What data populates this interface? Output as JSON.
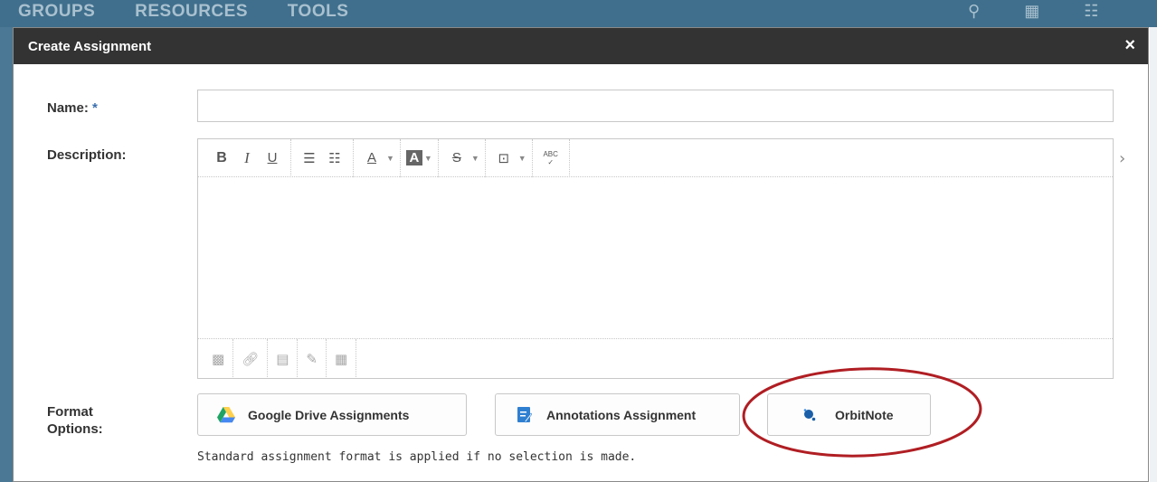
{
  "background": {
    "nav": [
      "GROUPS",
      "RESOURCES",
      "TOOLS"
    ],
    "icons": [
      "search-icon",
      "grid-icon",
      "apps-icon"
    ]
  },
  "dialog": {
    "title": "Create Assignment",
    "close_label": "×",
    "name_label": "Name:",
    "required_mark": "*",
    "name_value": "",
    "description_label": "Description:",
    "format_label_line1": "Format",
    "format_label_line2": "Options:",
    "toolbar": {
      "bold": "B",
      "italic": "I",
      "underline": "U",
      "bullet_list": "☰",
      "numbered_list": "☷",
      "font_color": "A",
      "highlight": "A",
      "strike": "S",
      "insert": "⊡",
      "spellcheck": "ABC"
    },
    "format_options": [
      {
        "label": "Google Drive Assignments",
        "icon": "google-drive-icon"
      },
      {
        "label": "Annotations Assignment",
        "icon": "annotations-icon"
      },
      {
        "label": "OrbitNote",
        "icon": "orbitnote-icon"
      }
    ],
    "hint": "Standard assignment format is applied if no selection is made."
  },
  "colors": {
    "header_bg": "#333333",
    "app_bar": "#3f6f8c",
    "required": "#3a6fb0",
    "highlight_oval": "#b01e23",
    "drive_green": "#1fa463",
    "drive_yellow": "#ffd04b",
    "drive_blue": "#4688f1"
  }
}
